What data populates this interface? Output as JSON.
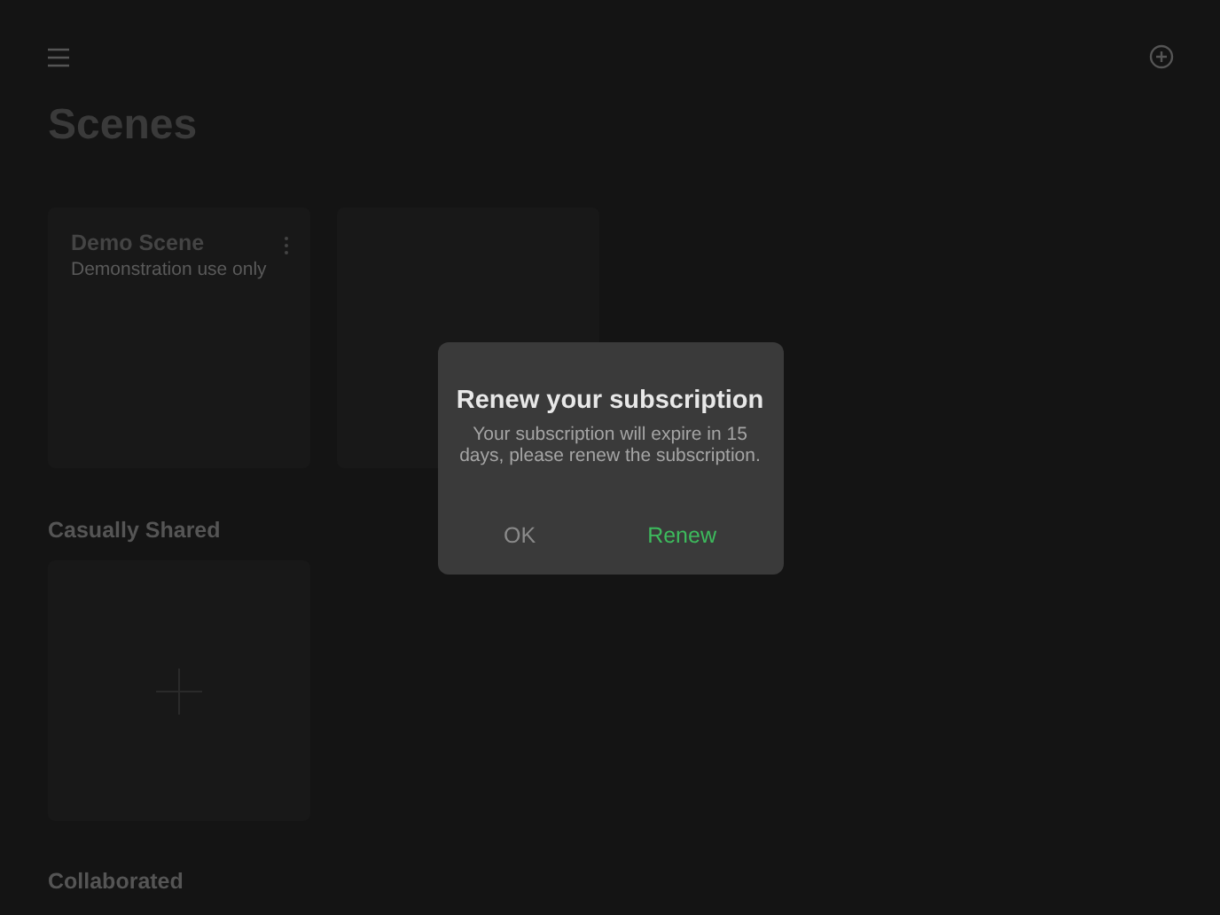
{
  "title": "Scenes",
  "scenes": [
    {
      "kind": "scene",
      "name": "Demo Scene",
      "description": "Demonstration use only"
    },
    {
      "kind": "blank"
    }
  ],
  "sections": [
    {
      "title": "Casually Shared",
      "cards": [
        {
          "kind": "add"
        }
      ]
    },
    {
      "title": "Collaborated"
    }
  ],
  "dialog": {
    "title": "Renew your subscription",
    "message": "Your subscription will expire in 15 days, please renew the subscription.",
    "buttons": [
      {
        "label": "OK",
        "kind": "cancel"
      },
      {
        "label": "Renew",
        "kind": "primary"
      }
    ]
  }
}
